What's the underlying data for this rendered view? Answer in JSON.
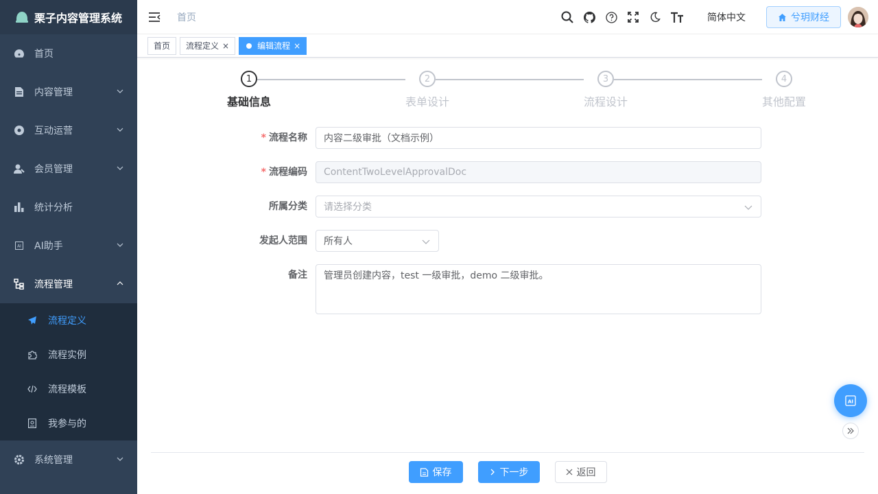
{
  "app": {
    "title": "栗子内容管理系统"
  },
  "sidebar": {
    "items": [
      {
        "label": "首页",
        "icon": "dashboard-icon"
      },
      {
        "label": "内容管理",
        "icon": "document-icon"
      },
      {
        "label": "互动运营",
        "icon": "compass-icon"
      },
      {
        "label": "会员管理",
        "icon": "user-icon"
      },
      {
        "label": "统计分析",
        "icon": "bar-chart-icon"
      },
      {
        "label": "AI助手",
        "icon": "ai-icon"
      },
      {
        "label": "流程管理",
        "icon": "workflow-icon"
      }
    ],
    "workflow_sub": [
      {
        "label": "流程定义",
        "icon": "send-icon",
        "active": true
      },
      {
        "label": "流程实例",
        "icon": "puzzle-icon"
      },
      {
        "label": "流程模板",
        "icon": "code-icon"
      },
      {
        "label": "我参与的",
        "icon": "id-card-icon"
      }
    ],
    "system": {
      "label": "系统管理",
      "icon": "gear-icon"
    }
  },
  "header": {
    "breadcrumb": "首页",
    "language": "简体中文",
    "tenant": "兮玥财经"
  },
  "tags": [
    {
      "label": "首页"
    },
    {
      "label": "流程定义"
    },
    {
      "label": "编辑流程"
    }
  ],
  "steps": [
    {
      "num": "1",
      "label": "基础信息"
    },
    {
      "num": "2",
      "label": "表单设计"
    },
    {
      "num": "3",
      "label": "流程设计"
    },
    {
      "num": "4",
      "label": "其他配置"
    }
  ],
  "form": {
    "name": {
      "label": "流程名称",
      "value": "内容二级审批（文档示例）"
    },
    "code": {
      "label": "流程编码",
      "value": "ContentTwoLevelApprovalDoc"
    },
    "category": {
      "label": "所属分类",
      "placeholder": "请选择分类"
    },
    "initiator": {
      "label": "发起人范围",
      "value": "所有人"
    },
    "remark": {
      "label": "备注",
      "value": "管理员创建内容，test 一级审批，demo 二级审批。"
    }
  },
  "footer": {
    "save": "保存",
    "next": "下一步",
    "back": "返回"
  },
  "colors": {
    "primary": "#409eff",
    "sidebar_bg": "#304156",
    "submenu_bg": "#1f2d3d"
  }
}
